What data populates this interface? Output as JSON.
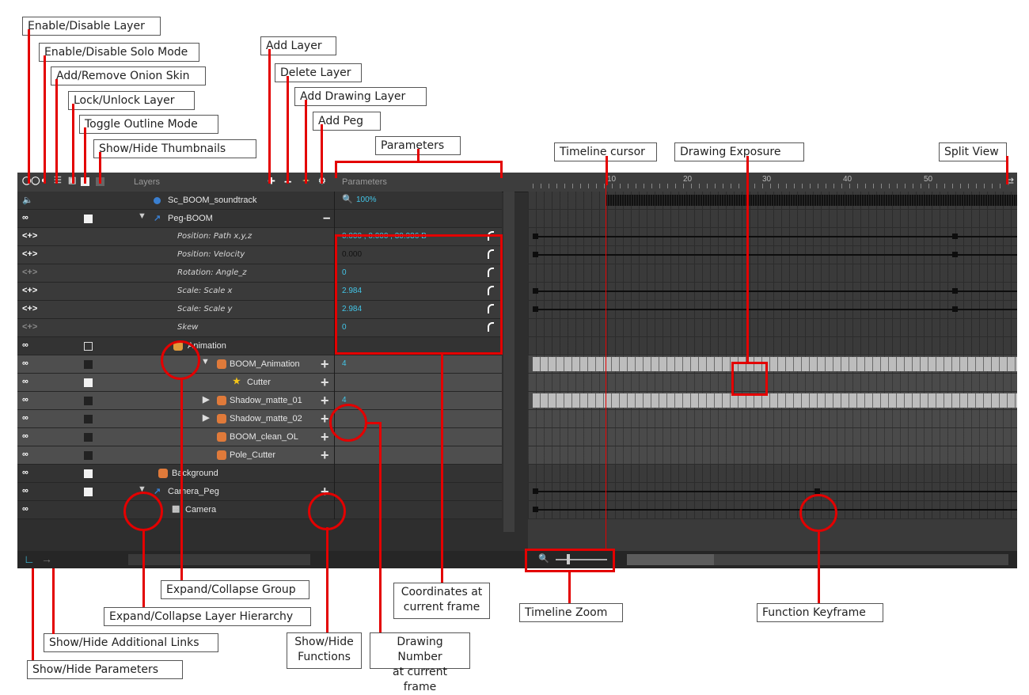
{
  "callouts": {
    "enable_disable_layer": "Enable/Disable Layer",
    "solo_mode": "Enable/Disable Solo Mode",
    "onion_skin": "Add/Remove Onion Skin",
    "lock_layer": "Lock/Unlock Layer",
    "outline_mode": "Toggle Outline Mode",
    "thumbnails": "Show/Hide Thumbnails",
    "add_layer": "Add Layer",
    "delete_layer": "Delete Layer",
    "add_drawing_layer": "Add Drawing Layer",
    "add_peg": "Add Peg",
    "parameters": "Parameters",
    "timeline_cursor": "Timeline cursor",
    "drawing_exposure": "Drawing Exposure",
    "split_view": "Split View",
    "expand_collapse_group": "Expand/Collapse Group",
    "expand_collapse_hierarchy": "Expand/Collapse Layer Hierarchy",
    "show_hide_links": "Show/Hide Additional Links",
    "show_hide_parameters": "Show/Hide Parameters",
    "show_hide_functions_1": "Show/Hide",
    "show_hide_functions_2": "Functions",
    "drawing_number_1": "Drawing Number",
    "drawing_number_2": "at current frame",
    "coordinates_1": "Coordinates at",
    "coordinates_2": "current frame",
    "timeline_zoom": "Timeline Zoom",
    "function_keyframe": "Function Keyframe"
  },
  "header": {
    "layers_label": "Layers",
    "parameters_label": "Parameters",
    "ruler_ticks": [
      "10",
      "20",
      "30",
      "40",
      "50"
    ]
  },
  "layers": [
    {
      "name": "Sc_BOOM_soundtrack",
      "value": "100%"
    },
    {
      "name": "Peg-BOOM",
      "value": ""
    },
    {
      "name": "Position: Path x,y,z",
      "value": "0.000 , 0.000 , 30.936 B"
    },
    {
      "name": "Position: Velocity",
      "value": "0.000"
    },
    {
      "name": "Rotation: Angle_z",
      "value": "0"
    },
    {
      "name": "Scale: Scale x",
      "value": "2.984"
    },
    {
      "name": "Scale: Scale y",
      "value": "2.984"
    },
    {
      "name": "Skew",
      "value": "0"
    },
    {
      "name": "Animation",
      "value": ""
    },
    {
      "name": "BOOM_Animation",
      "value": "4"
    },
    {
      "name": "Cutter",
      "value": ""
    },
    {
      "name": "Shadow_matte_01",
      "value": "4"
    },
    {
      "name": "Shadow_matte_02",
      "value": ""
    },
    {
      "name": "BOOM_clean_OL",
      "value": ""
    },
    {
      "name": "Pole_Cutter",
      "value": ""
    },
    {
      "name": "Background",
      "value": ""
    },
    {
      "name": "Camera_Peg",
      "value": ""
    },
    {
      "name": "Camera",
      "value": ""
    }
  ],
  "colors": {
    "accent": "#43c6e8",
    "annotation_red": "#e30000",
    "panel_bg": "#2e2e2e"
  }
}
